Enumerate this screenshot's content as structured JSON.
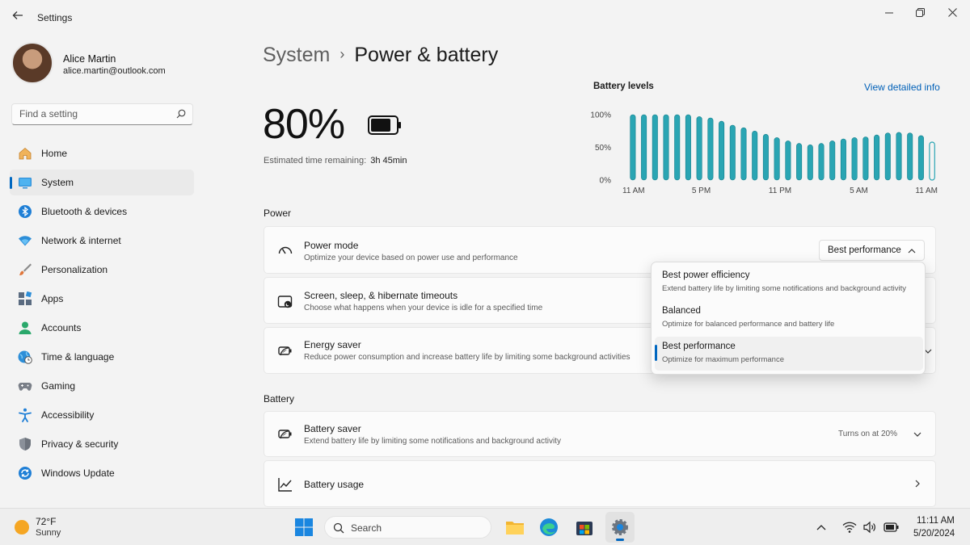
{
  "window": {
    "title": "Settings"
  },
  "user": {
    "name": "Alice Martin",
    "email": "alice.martin@outlook.com"
  },
  "search": {
    "placeholder": "Find a setting"
  },
  "nav": {
    "items": [
      {
        "label": "Home",
        "icon": "home-icon"
      },
      {
        "label": "System",
        "icon": "system-icon",
        "active": true
      },
      {
        "label": "Bluetooth & devices",
        "icon": "bluetooth-icon"
      },
      {
        "label": "Network & internet",
        "icon": "wifi-icon"
      },
      {
        "label": "Personalization",
        "icon": "brush-icon"
      },
      {
        "label": "Apps",
        "icon": "apps-icon"
      },
      {
        "label": "Accounts",
        "icon": "accounts-icon"
      },
      {
        "label": "Time & language",
        "icon": "globe-clock-icon"
      },
      {
        "label": "Gaming",
        "icon": "gamepad-icon"
      },
      {
        "label": "Accessibility",
        "icon": "accessibility-icon"
      },
      {
        "label": "Privacy & security",
        "icon": "shield-icon"
      },
      {
        "label": "Windows Update",
        "icon": "update-icon"
      }
    ]
  },
  "breadcrumb": {
    "parent": "System",
    "separator": "›",
    "current": "Power & battery"
  },
  "battery": {
    "percent_text": "80%",
    "level": 0.8,
    "estimate_label": "Estimated time remaining:",
    "estimate_value": "3h 45min"
  },
  "chart_header": {
    "title": "Battery levels",
    "link": "View detailed info"
  },
  "chart_data": {
    "type": "bar",
    "title": "Battery levels",
    "xlabel": "",
    "ylabel": "",
    "ylim": [
      0,
      100
    ],
    "yticks": [
      "100%",
      "50%",
      "0%"
    ],
    "xticks": [
      "11 AM",
      "5 PM",
      "11 PM",
      "5 AM",
      "11 AM"
    ],
    "values": [
      100,
      100,
      100,
      100,
      100,
      100,
      97,
      95,
      90,
      84,
      80,
      75,
      70,
      65,
      60,
      56,
      54,
      56,
      60,
      63,
      65,
      66,
      69,
      72,
      73,
      72,
      68,
      58
    ],
    "last_bar_outlined": true,
    "grid": false,
    "legend": "none",
    "colors": {
      "bar": "#2aa5b3",
      "bar_dark": "#127f8c"
    }
  },
  "sections": {
    "power": "Power",
    "battery": "Battery"
  },
  "power_mode": {
    "title": "Power mode",
    "description": "Optimize your device based on power use and performance",
    "selected": "Best performance",
    "options": [
      {
        "title": "Best power efficiency",
        "description": "Extend battery life by limiting some notifications and background activity"
      },
      {
        "title": "Balanced",
        "description": "Optimize for balanced performance and battery life"
      },
      {
        "title": "Best performance",
        "description": "Optimize for maximum performance",
        "selected": true
      }
    ]
  },
  "screen_sleep": {
    "title": "Screen, sleep, & hibernate timeouts",
    "description": "Choose what happens when your device is idle for a specified time"
  },
  "energy_saver": {
    "title": "Energy saver",
    "description": "Reduce power consumption and increase battery life by limiting some background activities"
  },
  "battery_saver": {
    "title": "Battery saver",
    "description": "Extend battery life by limiting some notifications and background activity",
    "status": "Turns on at 20%"
  },
  "battery_usage": {
    "title": "Battery usage"
  },
  "taskbar": {
    "weather": {
      "temp": "72°F",
      "condition": "Sunny"
    },
    "search": "Search",
    "time": "11:11 AM",
    "date": "5/20/2024"
  },
  "colors": {
    "accent": "#0067c0",
    "link": "#0060b8"
  }
}
